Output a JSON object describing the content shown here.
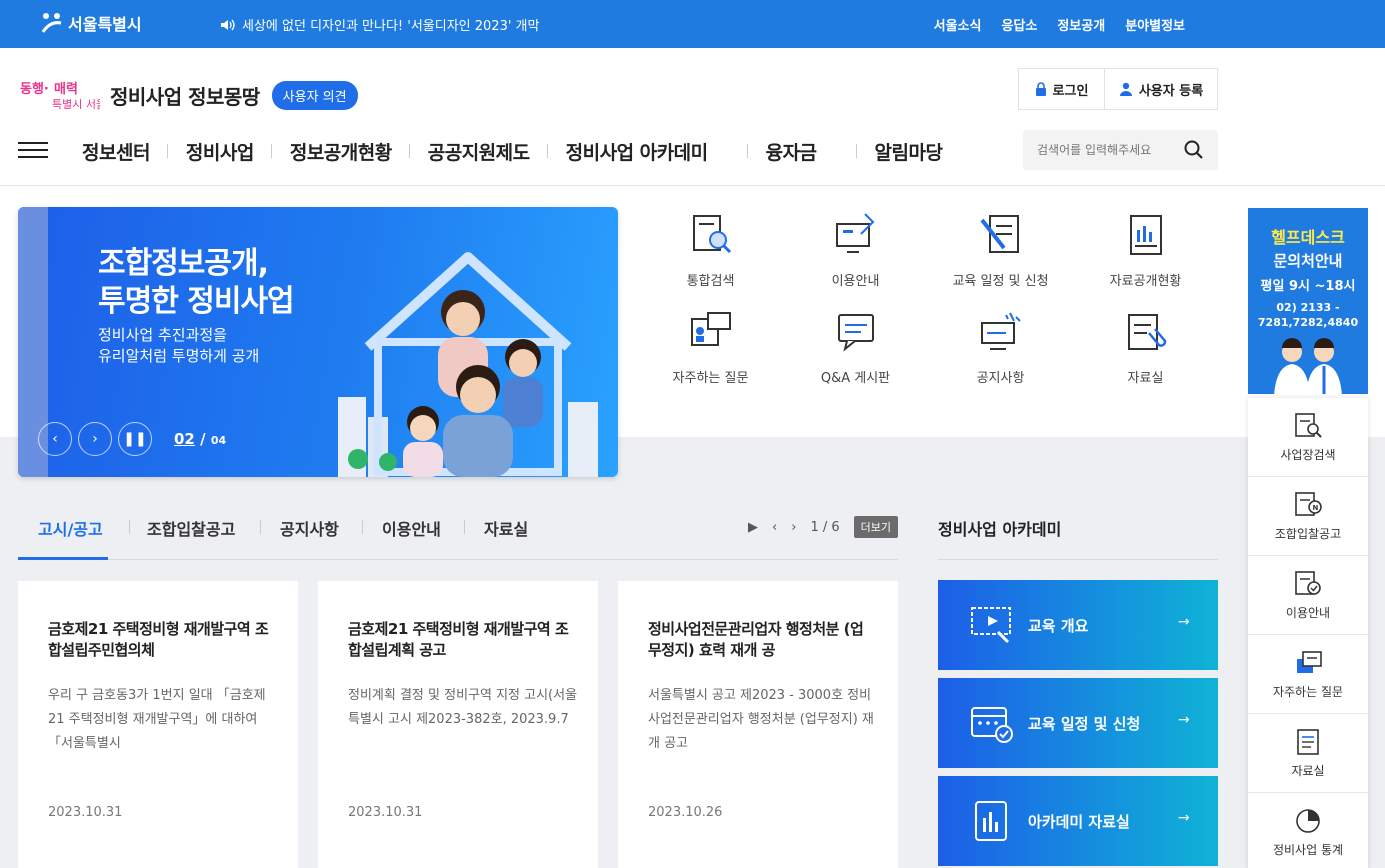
{
  "topbar": {
    "logo_text": "서울특별시",
    "notice": "세상에 없던 디자인과 만나다! '서울디자인 2023' 개막",
    "links": [
      "서울소식",
      "응답소",
      "정보공개",
      "분야별정보"
    ]
  },
  "header": {
    "slogan": "동행·매력 특별시 서울",
    "title": "정비사업 정보몽땅",
    "badge": "사용자 의견",
    "login": "로그인",
    "register": "사용자 등록"
  },
  "gnb": {
    "items": [
      "정보센터",
      "정비사업",
      "정보공개현황",
      "공공지원제도",
      "정비사업 아카데미",
      "융자금",
      "알림마당"
    ],
    "search_placeholder": "검색어를 입력해주세요"
  },
  "hero": {
    "title_line1": "조합정보공개,",
    "title_line2": "투명한 정비사업",
    "sub_line1": "정비사업 추진과정을",
    "sub_line2": "유리알처럼 투명하게 공개",
    "current": "02",
    "slash": "/",
    "total": "04"
  },
  "quick": [
    {
      "label": "통합검색",
      "icon": "search-document-icon"
    },
    {
      "label": "이용안내",
      "icon": "guide-computer-icon"
    },
    {
      "label": "교육 일정 및 신청",
      "icon": "education-pen-icon"
    },
    {
      "label": "자료공개현황",
      "icon": "chart-document-icon"
    },
    {
      "label": "자주하는 질문",
      "icon": "faq-board-icon"
    },
    {
      "label": "Q&A 게시판",
      "icon": "qa-chat-icon"
    },
    {
      "label": "공지사항",
      "icon": "notice-monitor-icon"
    },
    {
      "label": "자료실",
      "icon": "archive-clip-icon"
    }
  ],
  "helpdesk": {
    "line1": "헬프데스크",
    "line2": "문의처안내",
    "hours": "평일 9시 ~18시",
    "phone1": "02) 2133 -",
    "phone2": "7281,7282,4840"
  },
  "side_menu": [
    "사업장검색",
    "조합입찰공고",
    "이용안내",
    "자주하는 질문",
    "자료실",
    "정비사업 통계"
  ],
  "tabs": {
    "items": [
      "고시/공고",
      "조합입찰공고",
      "공지사항",
      "이용안내",
      "자료실"
    ],
    "page": "1 / 6",
    "more": "더보기"
  },
  "cards": [
    {
      "title": "금호제21 주택정비형 재개발구역 조합설립주민협의체",
      "body": "우리 구 금호동3가 1번지 일대 「금호제21 주택정비형 재개발구역」에 대하여「서울특별시",
      "date": "2023.10.31"
    },
    {
      "title": "금호제21 주택정비형 재개발구역 조합설립계획 공고",
      "body": "정비계획 결정 및 정비구역 지정 고시(서울특별시 고시 제2023-382호, 2023.9.7",
      "date": "2023.10.31"
    },
    {
      "title": "정비사업전문관리업자 행정처분 (업무정지) 효력 재개 공",
      "body": "서울특별시 공고 제2023 - 3000호 정비사업전문관리업자 행정처분 (업무정지) 재개 공고",
      "date": "2023.10.26"
    }
  ],
  "academy": {
    "title": "정비사업 아카데미",
    "items": [
      "교육 개요",
      "교육 일정 및 신청",
      "아카데미 자료실"
    ],
    "arrow": "→"
  }
}
